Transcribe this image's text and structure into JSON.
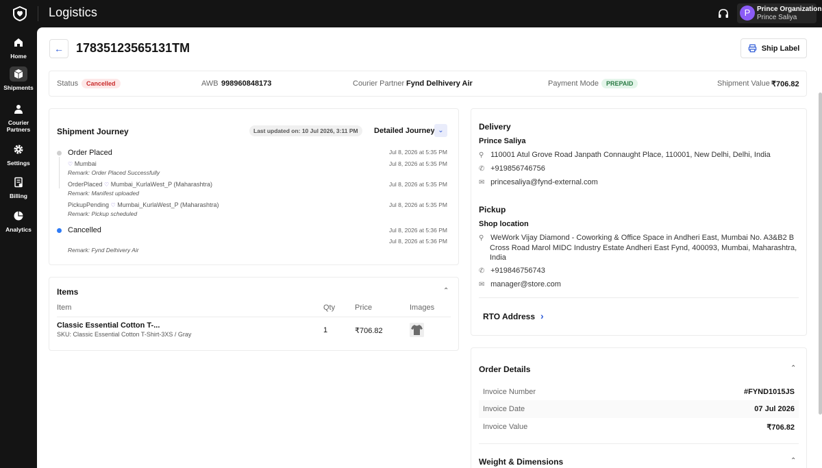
{
  "app": {
    "title": "Logistics"
  },
  "user": {
    "avatar_letter": "P",
    "org": "Prince Organization",
    "name": "Prince Saliya"
  },
  "nav": [
    {
      "label": "Home",
      "icon": "home-icon"
    },
    {
      "label": "Shipments",
      "icon": "box-icon"
    },
    {
      "label": "Courier Partners",
      "icon": "person-icon"
    },
    {
      "label": "Settings",
      "icon": "gear-icon"
    },
    {
      "label": "Billing",
      "icon": "billing-icon"
    },
    {
      "label": "Analytics",
      "icon": "pie-chart-icon"
    }
  ],
  "header": {
    "back": "←",
    "shipment_id": "17835123565131TM",
    "ship_label": "Ship Label"
  },
  "status": {
    "status_label": "Status",
    "status_value": "Cancelled",
    "awb_label": "AWB",
    "awb_value": "998960848173",
    "courier_label": "Courier Partner",
    "courier_value": "Fynd Delhivery Air",
    "payment_label": "Payment Mode",
    "payment_value": "PREPAID",
    "value_label": "Shipment Value",
    "value_value": "₹706.82"
  },
  "journey": {
    "title": "Shipment Journey",
    "last_updated": "Last updated on: 10 Jul 2026, 3:11 PM",
    "detailed": "Detailed Journey",
    "events": [
      {
        "title": "Order Placed",
        "location": "Mumbai",
        "remark": "Remark: Order Placed Successfully",
        "date1": "Jul 8, 2026 at 5:35 PM",
        "date2": "Jul 8, 2026 at 5:35 PM"
      },
      {
        "title": "OrderPlaced",
        "location": "Mumbai_KurlaWest_P (Maharashtra)",
        "remark": "Remark: Manifest uploaded",
        "date1": "Jul 8, 2026 at 5:35 PM"
      },
      {
        "title": "PickupPending",
        "location": "Mumbai_KurlaWest_P (Maharashtra)",
        "remark": "Remark: Pickup scheduled",
        "date1": "Jul 8, 2026 at 5:35 PM"
      },
      {
        "title": "Cancelled",
        "remark": "Remark: Fynd Delhivery Air",
        "date1": "Jul 8, 2026 at 5:36 PM",
        "date2": "Jul 8, 2026 at 5:36 PM"
      }
    ]
  },
  "items": {
    "title": "Items",
    "headers": {
      "item": "Item",
      "qty": "Qty",
      "price": "Price",
      "images": "Images"
    },
    "rows": [
      {
        "name": "Classic Essential Cotton T-...",
        "sku": "SKU: Classic Essential Cotton T-Shirt-3XS / Gray",
        "qty": "1",
        "price": "₹706.82"
      }
    ]
  },
  "delivery": {
    "title": "Delivery",
    "name": "Prince Saliya",
    "address": "110001 Atul Grove Road Janpath Connaught Place, 110001, New Delhi, Delhi, India",
    "phone": "+919856746756",
    "email": "princesaliya@fynd-external.com"
  },
  "pickup": {
    "title": "Pickup",
    "name": "Shop location",
    "address_line1": "WeWork Vijay Diamond - Coworking & Office Space in Andheri East, Mumbai No. A3&B2 B",
    "address_line2": "Cross Road Marol MIDC Industry Estate Andheri East Fynd, 400093, Mumbai, Maharashtra,",
    "address_line3": "India",
    "phone": "+919846756743",
    "email": "manager@store.com"
  },
  "rto": {
    "title": "RTO Address"
  },
  "order_details": {
    "title": "Order Details",
    "rows": [
      {
        "key": "Invoice Number",
        "value": "#FYND1015JS"
      },
      {
        "key": "Invoice Date",
        "value": "07 Jul 2026"
      },
      {
        "key": "Invoice Value",
        "value": "₹706.82"
      }
    ]
  },
  "weight": {
    "title": "Weight & Dimensions"
  },
  "colors": {
    "accent": "#2e5bd7",
    "cancelled_bg": "#fde8e8",
    "cancelled_text": "#c92b2b",
    "prepaid_bg": "#e4f5ea",
    "prepaid_text": "#2a7a44",
    "avatar": "#8b5cf6"
  }
}
